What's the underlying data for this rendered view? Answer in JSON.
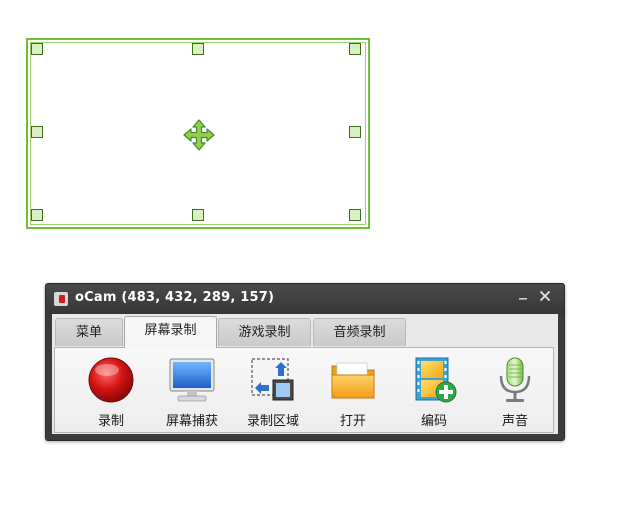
{
  "window": {
    "title": "oCam (483, 432, 289, 157)"
  },
  "tabs": [
    {
      "label": "菜单"
    },
    {
      "label": "屏幕录制"
    },
    {
      "label": "游戏录制"
    },
    {
      "label": "音频录制"
    }
  ],
  "active_tab": "屏幕录制",
  "toolbar": {
    "items": [
      {
        "label": "录制",
        "icon": "record-icon"
      },
      {
        "label": "屏幕捕获",
        "icon": "monitor-icon"
      },
      {
        "label": "录制区域",
        "icon": "resize-region-icon"
      },
      {
        "label": "打开",
        "icon": "folder-icon"
      },
      {
        "label": "编码",
        "icon": "film-add-icon"
      },
      {
        "label": "声音",
        "icon": "microphone-icon"
      }
    ]
  },
  "colors": {
    "frame_green": "#6fbf3a",
    "title_bar": "#3b3b3b",
    "record_red": "#d21b1b"
  }
}
